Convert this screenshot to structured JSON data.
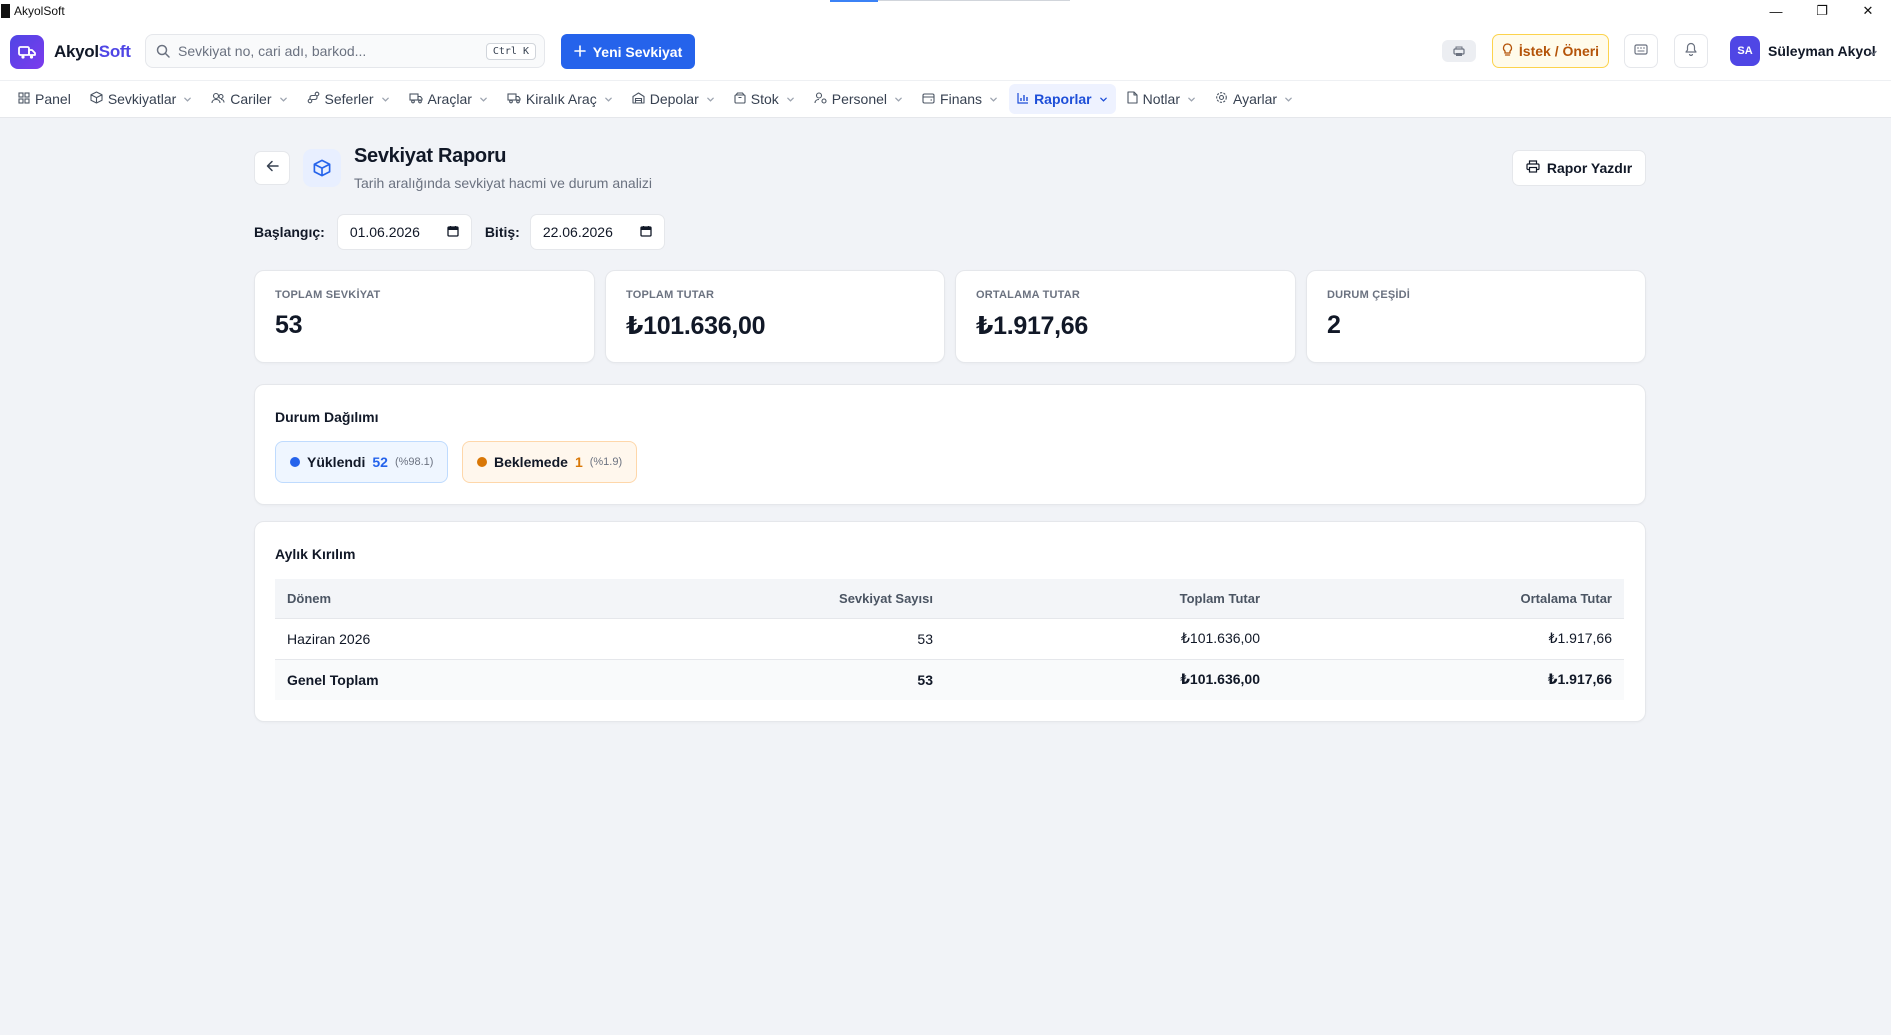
{
  "window": {
    "title": "AkyolSoft",
    "controls": [
      "—",
      "❐",
      "✕"
    ]
  },
  "header": {
    "logo_main": "Akyol",
    "logo_accent": "Soft",
    "search_placeholder": "Sevkiyat no, cari adı, barkod...",
    "search_shortcut": "Ctrl K",
    "new_button": "Yeni Sevkiyat",
    "idea_button": "İstek / Öneri",
    "avatar_initials": "SA",
    "user_name": "Süleyman Akyol"
  },
  "nav": {
    "items": [
      {
        "label": "Panel",
        "icon": "grid-icon"
      },
      {
        "label": "Sevkiyatlar",
        "icon": "package-icon"
      },
      {
        "label": "Cariler",
        "icon": "users-icon"
      },
      {
        "label": "Seferler",
        "icon": "route-icon"
      },
      {
        "label": "Araçlar",
        "icon": "truck-icon"
      },
      {
        "label": "Kiralık Araç",
        "icon": "truck-icon"
      },
      {
        "label": "Depolar",
        "icon": "warehouse-icon"
      },
      {
        "label": "Stok",
        "icon": "box-icon"
      },
      {
        "label": "Personel",
        "icon": "user-cog-icon"
      },
      {
        "label": "Finans",
        "icon": "wallet-icon"
      },
      {
        "label": "Raporlar",
        "icon": "bar-chart-icon",
        "active": true
      },
      {
        "label": "Notlar",
        "icon": "file-icon"
      },
      {
        "label": "Ayarlar",
        "icon": "gear-icon"
      }
    ]
  },
  "page": {
    "title": "Sevkiyat Raporu",
    "subtitle": "Tarih aralığında sevkiyat hacmi ve durum analizi",
    "print_button": "Rapor Yazdır",
    "start_label": "Başlangıç:",
    "start_value": "01.06.2026",
    "end_label": "Bitiş:",
    "end_value": "22.06.2026"
  },
  "stats": [
    {
      "label": "TOPLAM SEVKİYAT",
      "value": "53"
    },
    {
      "label": "TOPLAM TUTAR",
      "value": "₺101.636,00"
    },
    {
      "label": "ORTALAMA TUTAR",
      "value": "₺1.917,66"
    },
    {
      "label": "DURUM ÇEŞİDİ",
      "value": "2"
    }
  ],
  "status_section": {
    "title": "Durum Dağılımı",
    "items": [
      {
        "name": "Yüklendi",
        "count": "52",
        "pct": "(%98.1)",
        "color": "#2563eb",
        "bg": "#eff6ff",
        "border": "#bfdbfe"
      },
      {
        "name": "Beklemede",
        "count": "1",
        "pct": "(%1.9)",
        "color": "#d97706",
        "bg": "#fff7ed",
        "border": "#fed7aa"
      }
    ]
  },
  "monthly": {
    "title": "Aylık Kırılım",
    "columns": [
      "Dönem",
      "Sevkiyat Sayısı",
      "Toplam Tutar",
      "Ortalama Tutar"
    ],
    "rows": [
      [
        "Haziran 2026",
        "53",
        "₺101.636,00",
        "₺1.917,66"
      ]
    ],
    "total": [
      "Genel Toplam",
      "53",
      "₺101.636,00",
      "₺1.917,66"
    ]
  },
  "colors": {
    "primary": "#2563eb",
    "brand": "#4f46e5",
    "background": "#f1f3f7"
  }
}
